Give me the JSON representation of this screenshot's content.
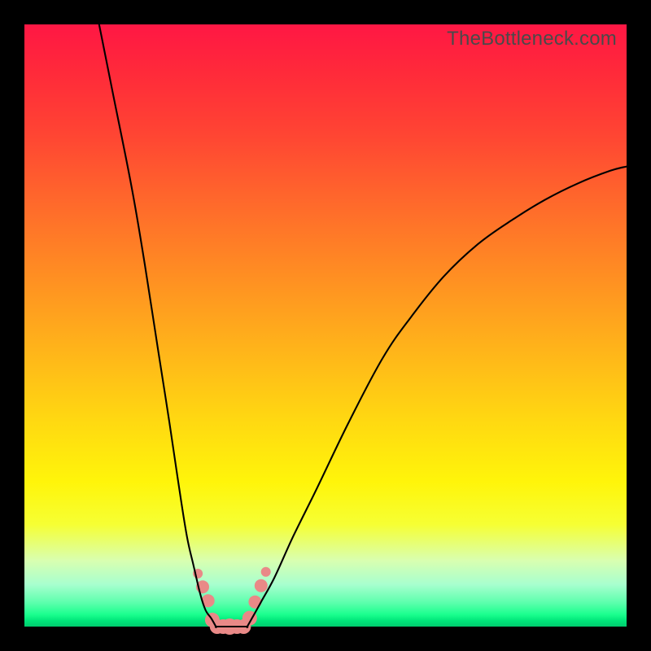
{
  "watermark": "TheBottleneck.com",
  "colors": {
    "background": "#000000",
    "gradient_top": "#ff1744",
    "gradient_bottom": "#00cc6e",
    "curve": "#000000",
    "marker": "#e98987"
  },
  "chart_data": {
    "type": "line",
    "title": "",
    "xlabel": "",
    "ylabel": "",
    "xlim": [
      0,
      100
    ],
    "ylim": [
      0,
      100
    ],
    "note": "No axis ticks or numeric labels are rendered in the image; values below are normalized 0-100 estimates read from pixel positions (y: 0 = bottom/green, 100 = top/red).",
    "series": [
      {
        "name": "left-branch",
        "x": [
          12.4,
          14.7,
          17.8,
          20.0,
          22.2,
          24.1,
          25.7,
          27.0,
          28.1,
          29.2,
          30.1,
          31.0,
          31.8
        ],
        "y": [
          100.0,
          88.5,
          73.0,
          60.1,
          45.9,
          33.8,
          23.0,
          14.9,
          10.1,
          5.4,
          2.7,
          1.4,
          0.0
        ]
      },
      {
        "name": "valley",
        "x": [
          31.8,
          32.8,
          34.1,
          35.7,
          37.0
        ],
        "y": [
          0.0,
          0.0,
          0.0,
          0.0,
          0.0
        ]
      },
      {
        "name": "right-branch",
        "x": [
          37.0,
          37.8,
          39.3,
          41.5,
          44.6,
          48.6,
          53.8,
          59.5,
          64.2,
          69.6,
          75.3,
          81.1,
          86.5,
          91.9,
          97.3,
          100.0
        ],
        "y": [
          0.0,
          1.4,
          4.1,
          8.1,
          14.9,
          23.0,
          33.8,
          44.6,
          51.4,
          58.1,
          63.5,
          67.6,
          70.9,
          73.6,
          75.7,
          76.4
        ]
      }
    ],
    "markers": {
      "name": "highlighted-points",
      "points": [
        {
          "x": 28.8,
          "y": 8.8,
          "r": 6
        },
        {
          "x": 29.6,
          "y": 6.6,
          "r": 8
        },
        {
          "x": 30.5,
          "y": 4.3,
          "r": 8
        },
        {
          "x": 31.2,
          "y": 1.1,
          "r": 9
        },
        {
          "x": 32.0,
          "y": 0.0,
          "r": 9
        },
        {
          "x": 33.0,
          "y": 0.0,
          "r": 9
        },
        {
          "x": 34.1,
          "y": 0.0,
          "r": 10
        },
        {
          "x": 35.3,
          "y": 0.0,
          "r": 9
        },
        {
          "x": 36.4,
          "y": 0.0,
          "r": 9
        },
        {
          "x": 37.4,
          "y": 1.4,
          "r": 9
        },
        {
          "x": 38.3,
          "y": 4.1,
          "r": 8
        },
        {
          "x": 39.3,
          "y": 6.8,
          "r": 8
        },
        {
          "x": 40.1,
          "y": 9.1,
          "r": 6
        }
      ]
    }
  }
}
